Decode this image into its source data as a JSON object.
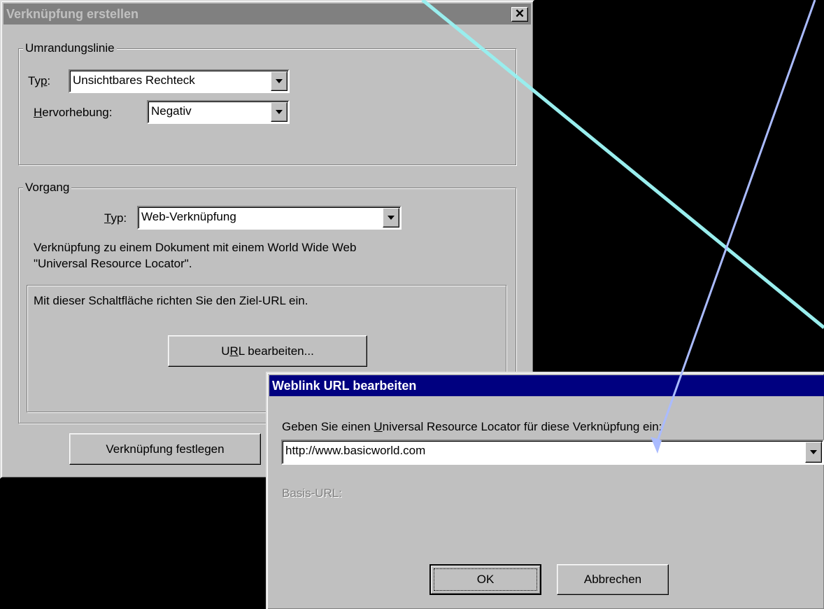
{
  "dialog1": {
    "title": "Verknüpfung erstellen",
    "close_glyph": "✕",
    "border_group": {
      "legend": "Umrandungslinie",
      "type_label_pre": "Ty",
      "type_label_key": "p",
      "type_label_post": ":",
      "type_value": "Unsichtbares Rechteck",
      "highlight_label_key": "H",
      "highlight_label_rest": "ervorhebung:",
      "highlight_value": "Negativ"
    },
    "action_group": {
      "legend": "Vorgang",
      "type_label_key": "T",
      "type_label_rest": "yp:",
      "type_value": "Web-Verknüpfung",
      "description_line1": "Verknüpfung zu einem Dokument mit einem World Wide Web",
      "description_line2": "\"Universal Resource Locator\".",
      "inner_text": "Mit dieser Schaltfläche richten Sie den Ziel-URL ein.",
      "url_button_pre": "U",
      "url_button_key": "R",
      "url_button_post": "L bearbeiten..."
    },
    "set_link_button": "Verknüpfung festlegen"
  },
  "dialog2": {
    "title": "Weblink URL bearbeiten",
    "prompt_pre": "Geben Sie einen ",
    "prompt_key": "U",
    "prompt_post": "niversal Resource Locator für diese Verknüpfung ein:",
    "url_value": "http://www.basicworld.com",
    "base_url_label": "Basis-URL:",
    "ok_button": "OK",
    "cancel_button": "Abbrechen"
  },
  "colors": {
    "background": "#000000",
    "window_face": "#c0c0c0",
    "active_title": "#000080",
    "inactive_title": "#808080",
    "arrow_cyan": "#99eeee",
    "arrow_blue": "#aabbff"
  }
}
